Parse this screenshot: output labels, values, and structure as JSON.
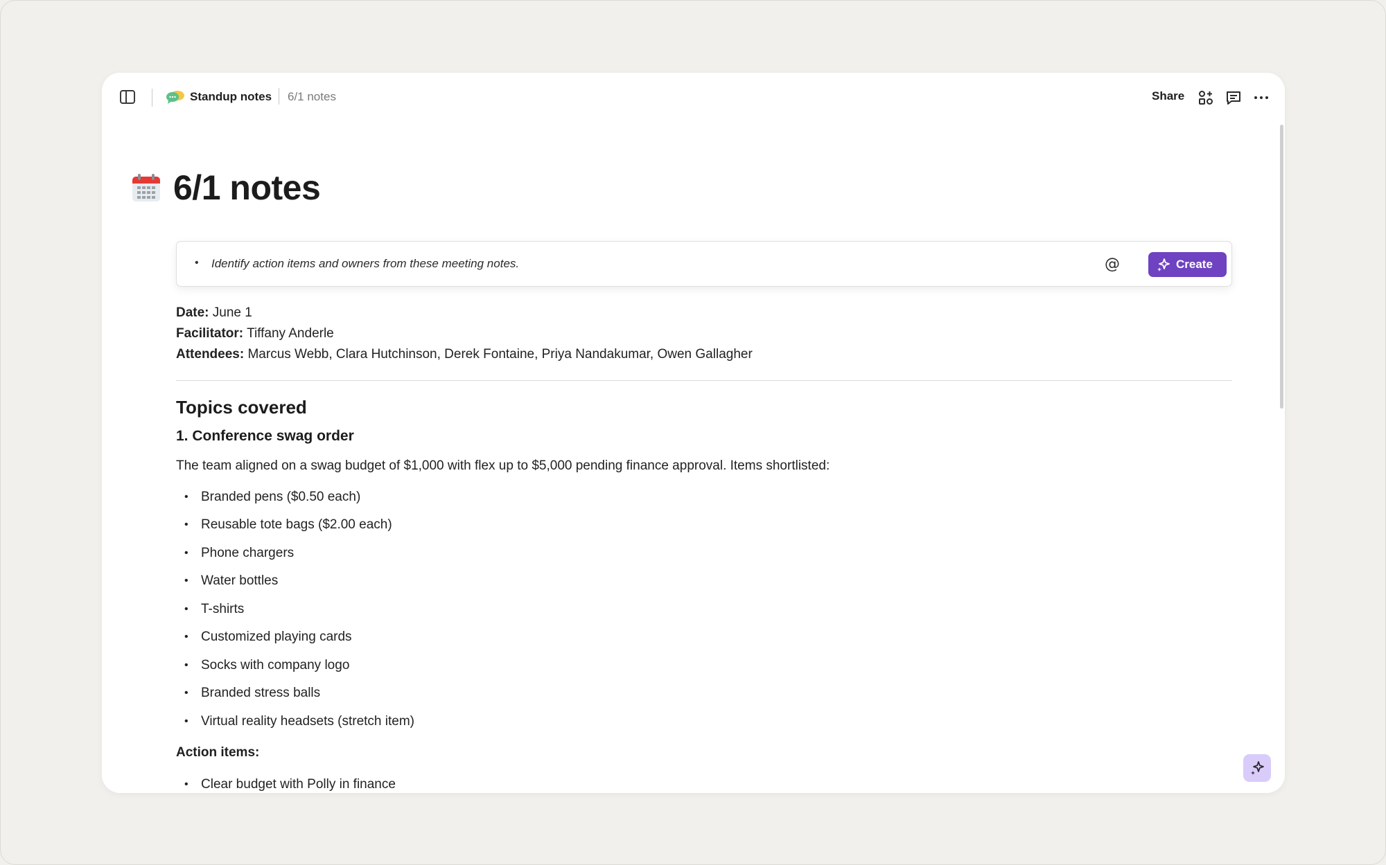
{
  "header": {
    "parent_page": "Standup notes",
    "current_page": "6/1 notes",
    "share_label": "Share"
  },
  "page": {
    "title": "6/1 notes",
    "icon": "calendar-icon"
  },
  "ai_prompt": {
    "value": "Identify action items and owners from these meeting notes.",
    "mention_symbol": "@",
    "create_label": "Create"
  },
  "meta": {
    "date_label": "Date:",
    "date_value": "June 1",
    "facilitator_label": "Facilitator:",
    "facilitator_value": "Tiffany Anderle",
    "attendees_label": "Attendees:",
    "attendees_value": "Marcus Webb, Clara Hutchinson, Derek Fontaine, Priya Nandakumar, Owen Gallagher"
  },
  "topics": {
    "heading": "Topics covered",
    "section_title": "1. Conference swag order",
    "intro": "The team aligned on a swag budget of $1,000 with flex up to $5,000 pending finance approval. Items shortlisted:",
    "items": [
      "Branded pens ($0.50 each)",
      "Reusable tote bags ($2.00 each)",
      "Phone chargers",
      "Water bottles",
      "T-shirts",
      "Customized playing cards",
      "Socks with company logo",
      "Branded stress balls",
      "Virtual reality headsets (stretch item)"
    ],
    "action_heading": "Action items:",
    "action_items": [
      "Clear budget with Polly in finance"
    ]
  },
  "colors": {
    "accent": "#6f42c1",
    "fab_background": "#d9ccfa",
    "page_background": "#f1f0ec"
  }
}
